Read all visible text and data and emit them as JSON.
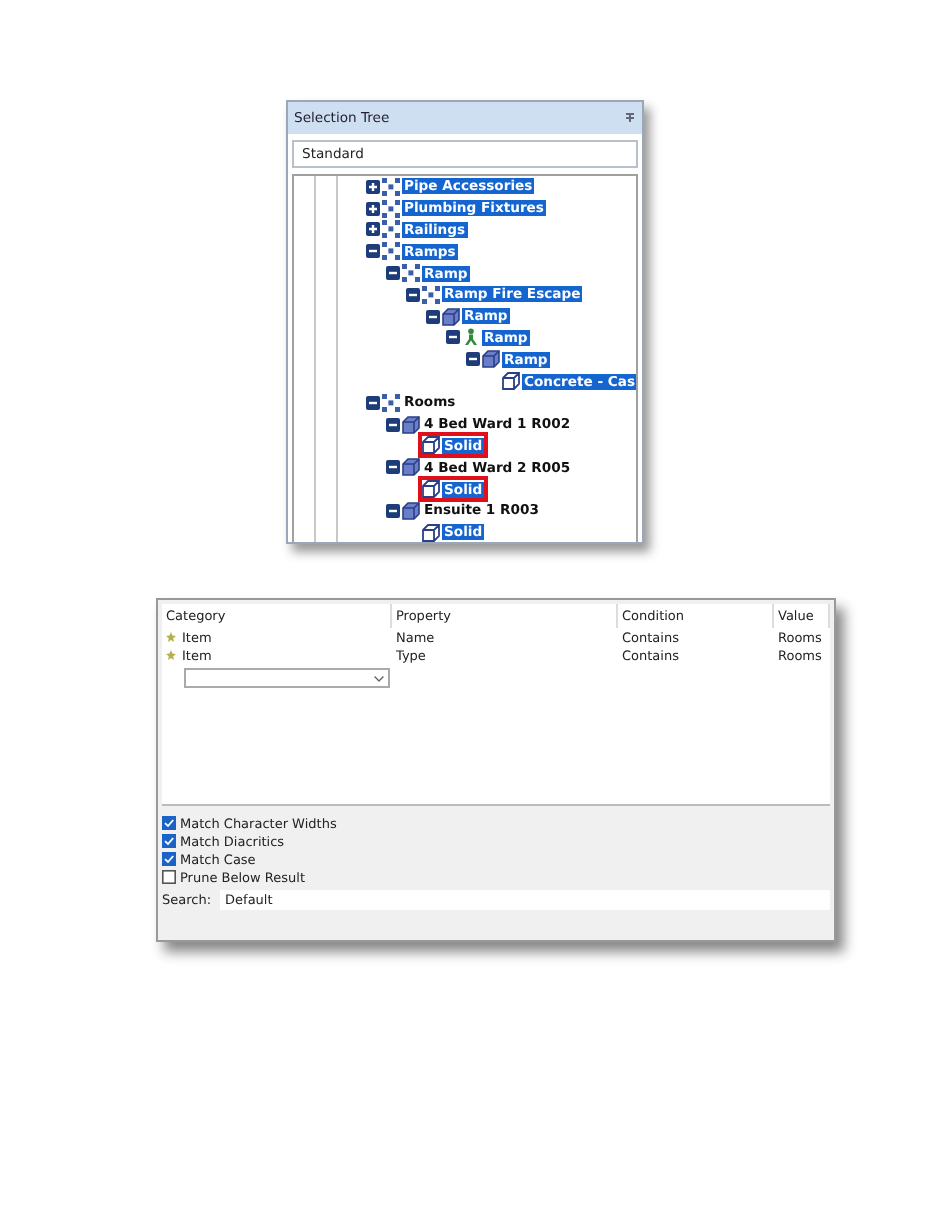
{
  "selection_tree": {
    "title": "Selection Tree",
    "mode": "Standard",
    "items": [
      {
        "label": "Pipe Accessories",
        "kind": "category",
        "expanded": false,
        "selected": true
      },
      {
        "label": "Plumbing Fixtures",
        "kind": "category",
        "expanded": false,
        "selected": true
      },
      {
        "label": "Railings",
        "kind": "category",
        "expanded": false,
        "selected": true
      },
      {
        "label": "Ramps",
        "kind": "category",
        "expanded": true,
        "selected": true,
        "children": [
          {
            "label": "Ramp",
            "kind": "category",
            "expanded": true,
            "selected": true,
            "children": [
              {
                "label": "Ramp Fire Escape",
                "kind": "category",
                "expanded": true,
                "selected": true,
                "children": [
                  {
                    "label": "Ramp",
                    "kind": "object",
                    "expanded": true,
                    "selected": true,
                    "children": [
                      {
                        "label": "Ramp",
                        "kind": "insert",
                        "expanded": true,
                        "selected": true,
                        "children": [
                          {
                            "label": "Ramp",
                            "kind": "object",
                            "expanded": true,
                            "selected": true,
                            "children": [
                              {
                                "label": "Concrete - Cas",
                                "kind": "solid",
                                "selected": true
                              }
                            ]
                          }
                        ]
                      }
                    ]
                  }
                ]
              }
            ]
          }
        ]
      },
      {
        "label": "Rooms",
        "kind": "category",
        "expanded": true,
        "selected": false,
        "children": [
          {
            "label": "4 Bed Ward 1 R002",
            "kind": "object",
            "expanded": true,
            "selected": false,
            "children": [
              {
                "label": "Solid",
                "kind": "solid",
                "selected": true,
                "flagged": true
              }
            ]
          },
          {
            "label": "4 Bed Ward 2 R005",
            "kind": "object",
            "expanded": true,
            "selected": false,
            "children": [
              {
                "label": "Solid",
                "kind": "solid",
                "selected": true,
                "flagged": true
              }
            ]
          },
          {
            "label": "Ensuite 1 R003",
            "kind": "object",
            "expanded": true,
            "selected": false,
            "children": [
              {
                "label": "Solid",
                "kind": "solid",
                "selected": true,
                "flagged": false
              }
            ]
          }
        ]
      }
    ]
  },
  "find_items": {
    "columns": [
      "Category",
      "Property",
      "Condition",
      "Value"
    ],
    "rows": [
      [
        "Item",
        "Name",
        "Contains",
        "Rooms"
      ],
      [
        "Item",
        "Type",
        "Contains",
        "Rooms"
      ]
    ],
    "options": [
      {
        "label": "Match Character Widths",
        "checked": true
      },
      {
        "label": "Match Diacritics",
        "checked": true
      },
      {
        "label": "Match Case",
        "checked": true
      },
      {
        "label": "Prune Below Result",
        "checked": false
      }
    ],
    "search": {
      "label": "Search:",
      "value": "Default"
    }
  }
}
